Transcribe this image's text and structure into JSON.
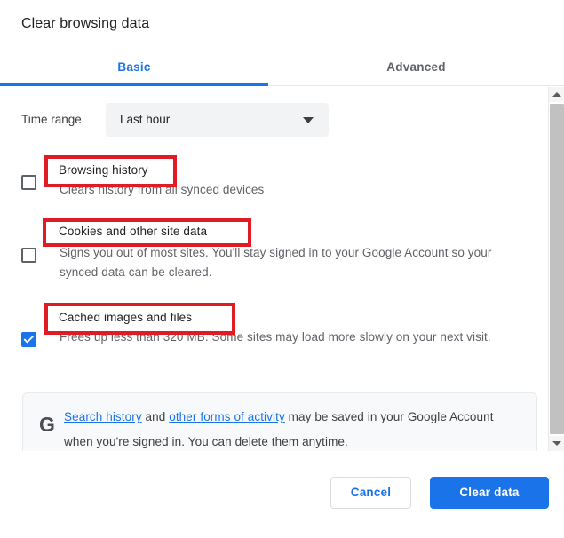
{
  "dialog": {
    "title": "Clear browsing data"
  },
  "tabs": [
    {
      "label": "Basic",
      "selected": true
    },
    {
      "label": "Advanced",
      "selected": false
    }
  ],
  "time_range": {
    "label": "Time range",
    "value": "Last hour",
    "icon": "chevron-down-icon"
  },
  "options": [
    {
      "title": "Browsing history",
      "description": "Clears history from all synced devices",
      "checked": false,
      "highlighted": true
    },
    {
      "title": "Cookies and other site data",
      "description": "Signs you out of most sites. You'll stay signed in to your Google Account so your synced data can be cleared.",
      "checked": false,
      "highlighted": true
    },
    {
      "title": "Cached images and files",
      "description": "Frees up less than 320 MB. Some sites may load more slowly on your next visit.",
      "checked": true,
      "highlighted": true
    }
  ],
  "google_panel": {
    "icon": "google-g-icon",
    "link1": "Search history",
    "mid_text": " and ",
    "link2": "other forms of activity",
    "tail_text": " may be saved in your Google Account when you're signed in. You can delete them anytime."
  },
  "footer": {
    "cancel_label": "Cancel",
    "clear_label": "Clear data"
  },
  "scrollbar": {
    "up_icon": "triangle-up-icon",
    "down_icon": "triangle-down-icon"
  },
  "colors": {
    "accent": "#1a73e8",
    "annotation": "#e01b24",
    "text_primary": "#202124",
    "text_secondary": "#5f6368",
    "field_bg": "#f1f3f4",
    "panel_bg": "#f8f9fa"
  }
}
